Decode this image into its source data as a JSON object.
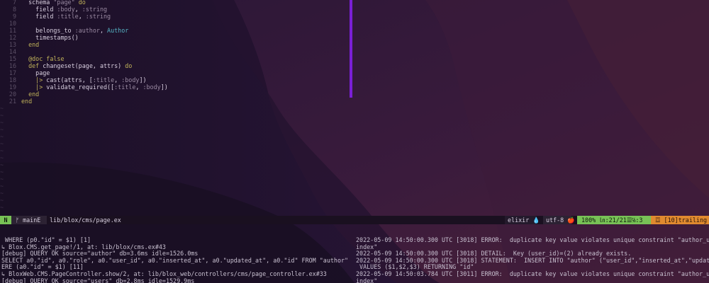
{
  "editor": {
    "lines": [
      {
        "num": "7",
        "parts": [
          {
            "t": "  schema ",
            "c": "fn"
          },
          {
            "t": "\"page\"",
            "c": "str"
          },
          {
            "t": " do",
            "c": "kw"
          }
        ]
      },
      {
        "num": "8",
        "parts": [
          {
            "t": "    field ",
            "c": "fn"
          },
          {
            "t": ":body",
            "c": "sym"
          },
          {
            "t": ", ",
            "c": "fn"
          },
          {
            "t": ":string",
            "c": "sym"
          }
        ]
      },
      {
        "num": "9",
        "parts": [
          {
            "t": "    field ",
            "c": "fn"
          },
          {
            "t": ":title",
            "c": "sym"
          },
          {
            "t": ", ",
            "c": "fn"
          },
          {
            "t": ":string",
            "c": "sym"
          }
        ]
      },
      {
        "num": "10",
        "parts": []
      },
      {
        "num": "11",
        "parts": [
          {
            "t": "    belongs_to ",
            "c": "fn"
          },
          {
            "t": ":author",
            "c": "sym"
          },
          {
            "t": ", ",
            "c": "fn"
          },
          {
            "t": "Author",
            "c": "const"
          }
        ]
      },
      {
        "num": "12",
        "parts": [
          {
            "t": "    timestamps()",
            "c": "fn"
          }
        ]
      },
      {
        "num": "13",
        "parts": [
          {
            "t": "  end",
            "c": "kw"
          }
        ]
      },
      {
        "num": "14",
        "parts": []
      },
      {
        "num": "15",
        "parts": [
          {
            "t": "  @doc false",
            "c": "kw"
          }
        ]
      },
      {
        "num": "16",
        "parts": [
          {
            "t": "  def ",
            "c": "kw"
          },
          {
            "t": "changeset(page, attrs) ",
            "c": "fn"
          },
          {
            "t": "do",
            "c": "kw"
          }
        ]
      },
      {
        "num": "17",
        "parts": [
          {
            "t": "    page",
            "c": "fn"
          }
        ]
      },
      {
        "num": "18",
        "parts": [
          {
            "t": "    |> ",
            "c": "kw"
          },
          {
            "t": "cast(attrs, [",
            "c": "fn"
          },
          {
            "t": ":title",
            "c": "sym"
          },
          {
            "t": ", ",
            "c": "fn"
          },
          {
            "t": ":body",
            "c": "sym"
          },
          {
            "t": "])",
            "c": "fn"
          }
        ]
      },
      {
        "num": "19",
        "parts": [
          {
            "t": "    |> ",
            "c": "kw"
          },
          {
            "t": "validate_required([",
            "c": "fn"
          },
          {
            "t": ":title",
            "c": "sym"
          },
          {
            "t": ", ",
            "c": "fn"
          },
          {
            "t": ":body",
            "c": "sym"
          },
          {
            "t": "])",
            "c": "fn"
          }
        ]
      },
      {
        "num": "20",
        "parts": [
          {
            "t": "  end",
            "c": "kw"
          }
        ]
      },
      {
        "num": "21",
        "parts": [
          {
            "t": "end",
            "c": "kw"
          }
        ]
      }
    ],
    "empty_marker": "~"
  },
  "statusline": {
    "mode": "N",
    "branch": "ᚠ mainE",
    "file": "lib/blox/cms/page.ex",
    "filetype": "elixir 💧",
    "encoding": "utf-8 🍎",
    "position": "100% ㏑:21/21☰℅:3",
    "warning": "☲ [10]trailing",
    "colors": {
      "mode": "#78c256",
      "warning": "#e08a2f",
      "split": "#7a1fd6"
    }
  },
  "terminal_left": [
    " WHERE (p0.\"id\" = $1) [1]",
    "↳ Blox.CMS.get_page!/1, at: lib/blox/cms.ex#43",
    "[debug] QUERY OK source=\"author\" db=3.6ms idle=1526.0ms",
    "SELECT a0.\"id\", a0.\"role\", a0.\"user_id\", a0.\"inserted_at\", a0.\"updated_at\", a0.\"id\" FROM \"author\" AS a0 WH",
    "ERE (a0.\"id\" = $1) [11]",
    "↳ BloxWeb.CMS.PageController.show/2, at: lib/blox_web/controllers/cms/page_controller.ex#33",
    "[debug] QUERY OK source=\"users\" db=2.8ms idle=1529.9ms"
  ],
  "terminal_right": [
    "2022-05-09 14:50:00.300 UTC [3018] ERROR:  duplicate key value violates unique constraint \"author_user_id_",
    "index\"",
    "2022-05-09 14:50:00.300 UTC [3018] DETAIL:  Key (user_id)=(2) already exists.",
    "2022-05-09 14:50:00.300 UTC [3018] STATEMENT:  INSERT INTO \"author\" (\"user_id\",\"inserted_at\",\"updated_at\")",
    " VALUES ($1,$2,$3) RETURNING \"id\"",
    "2022-05-09 14:50:03.784 UTC [3011] ERROR:  duplicate key value violates unique constraint \"author_user_id_",
    "index\""
  ]
}
